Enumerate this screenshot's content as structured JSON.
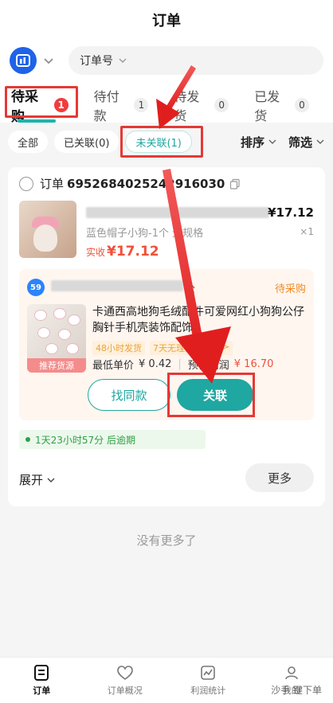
{
  "header": {
    "title": "订单"
  },
  "search": {
    "field_label": "订单号"
  },
  "tabs": [
    {
      "label": "待采购",
      "count": "1"
    },
    {
      "label": "待付款",
      "count": "1"
    },
    {
      "label": "待发货",
      "count": "0"
    },
    {
      "label": "已发货",
      "count": "0"
    }
  ],
  "filters": {
    "chips": [
      "全部",
      "已关联(0)",
      "未关联(1)"
    ],
    "sort": "排序",
    "filter": "筛选"
  },
  "order": {
    "prefix": "订单",
    "number": "6952684025242916030",
    "product": {
      "spec": "蓝色帽子小狗-1个 无规格",
      "price": "¥17.12",
      "qty": "×1",
      "paid_label": "实收",
      "paid_value": "¥17.12"
    },
    "source": {
      "supplier_suffix": "公",
      "status": "待采购",
      "tag": "推荐货源",
      "title": "卡通西高地狗毛绒配件可爱网红小狗狗公仔胸针手机壳装饰配饰",
      "badges": [
        "48小时发货",
        "7天无理由包退",
        ">"
      ],
      "min_price_label": "最低单价",
      "min_price": "¥ 0.42",
      "profit_label": "预估利润",
      "profit": "¥ 16.70",
      "find_btn": "找同款",
      "link_btn": "关联"
    },
    "deadline": "1天23小时57分 后逾期",
    "expand": "展开",
    "more": "更多"
  },
  "list_end": "没有更多了",
  "bottom_nav": [
    {
      "label": "订单",
      "icon": "order-icon"
    },
    {
      "label": "订单概况",
      "icon": "heart-icon"
    },
    {
      "label": "利润统计",
      "icon": "chart-icon"
    },
    {
      "label": "我的",
      "icon": "user-icon"
    }
  ],
  "watermark": "沙手 键下单",
  "colors": {
    "accent": "#1fa7a1",
    "alert": "#f03d3d",
    "annotation": "#e53935",
    "price": "#f0503a"
  }
}
